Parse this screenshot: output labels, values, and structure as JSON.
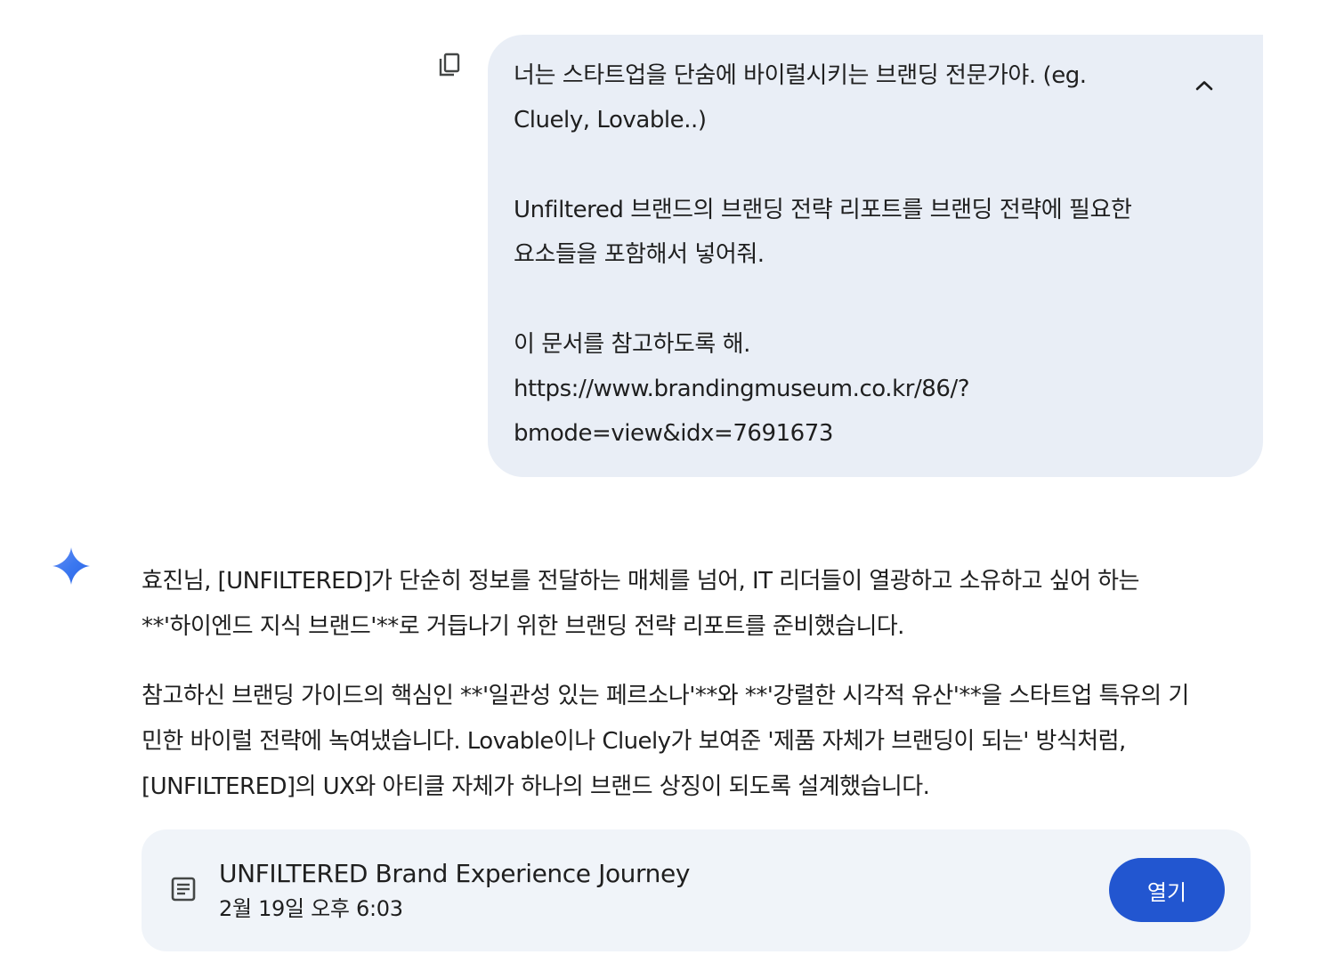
{
  "user_message": {
    "lines": [
      "너는 스타트업을 단숨에 바이럴시키는 브랜딩 전문가야. (eg.",
      "Cluely, Lovable..)",
      "",
      "Unfiltered 브랜드의 브랜딩 전략 리포트를 브랜딩 전략에 필요한",
      "요소들을 포함해서 넣어줘.",
      "",
      "이 문서를 참고하도록 해.",
      "https://www.brandingmuseum.co.kr/86/?",
      "bmode=view&idx=7691673"
    ],
    "copy_icon": "copy-icon",
    "collapse_icon": "chevron-up-icon"
  },
  "response": {
    "avatar_icon": "gemini-spark-icon",
    "paragraphs": [
      [
        "효진님, [UNFILTERED]가 단순히 정보를 전달하는 매체를 넘어, IT 리더들이 열광하고 소유하고 싶어 하는",
        "**'하이엔드 지식 브랜드'**로 거듭나기 위한 브랜딩 전략 리포트를 준비했습니다."
      ],
      [
        "참고하신 브랜딩 가이드의 핵심인 **'일관성 있는 페르소나'**와 **'강렬한 시각적 유산'**을 스타트업 특유의 기",
        "민한 바이럴 전략에 녹여냈습니다. Lovable이나 Cluely가 보여준 '제품 자체가 브랜딩이 되는' 방식처럼,",
        "[UNFILTERED]의 UX와 아티클 자체가 하나의 브랜드 상징이 되도록 설계했습니다."
      ]
    ]
  },
  "document_card": {
    "icon": "document-icon",
    "title": "UNFILTERED Brand Experience Journey",
    "timestamp": "2월 19일 오후 6:03",
    "open_label": "열기"
  },
  "colors": {
    "user_bubble_bg": "#e9eef6",
    "card_bg": "#f0f4f9",
    "open_button_bg": "#2256d0",
    "spark_blue": "#4285f4"
  }
}
